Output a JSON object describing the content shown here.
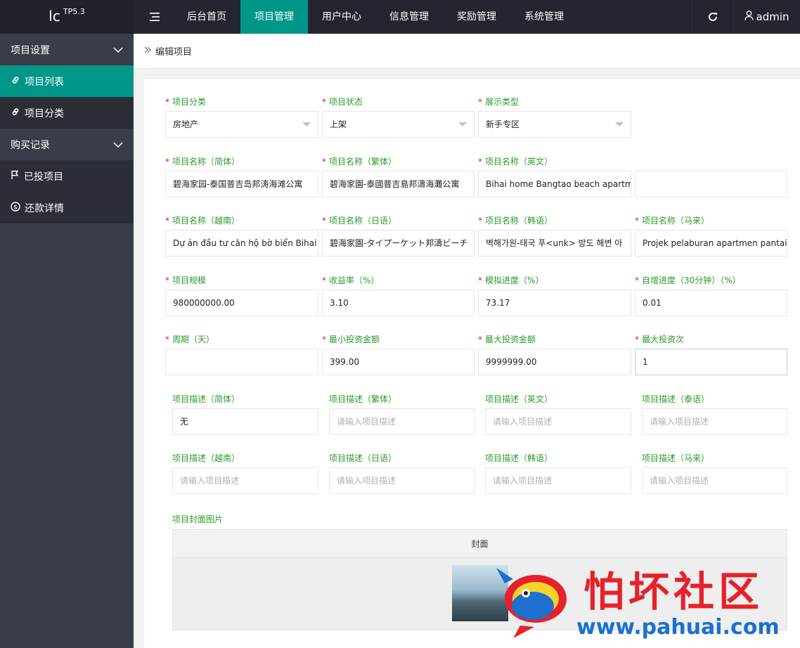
{
  "logo": {
    "text": "lc",
    "version": "TP5.3"
  },
  "nav": [
    "后台首页",
    "项目管理",
    "用户中心",
    "信息管理",
    "奖励管理",
    "系统管理"
  ],
  "user": {
    "name": "admin"
  },
  "sidebar": {
    "group1": "项目设置",
    "item_list": "项目列表",
    "item_category": "项目分类",
    "group2": "购买记录",
    "item_invested": "已投项目",
    "item_repay": "还款详情"
  },
  "breadcrumb": "编辑项目",
  "form": {
    "category": {
      "label": "项目分类",
      "value": "房地产"
    },
    "status": {
      "label": "项目状态",
      "value": "上架"
    },
    "display_type": {
      "label": "展示类型",
      "value": "新手专区"
    },
    "name_cn": {
      "label": "项目名称（简体）",
      "value": "碧海家园-泰国普吉岛邦涛海滩公寓"
    },
    "name_tw": {
      "label": "项目名称（繁体）",
      "value": "碧海家園-泰國普吉島邦濤海灘公寓"
    },
    "name_en": {
      "label": "项目名称（英文）",
      "value": "Bihai home Bangtao beach apartment"
    },
    "name_th": {
      "label": "",
      "value": ""
    },
    "name_vi": {
      "label": "项目名称（越南）",
      "value": "Dự án đầu tư căn hộ bờ biển Bihai ở"
    },
    "name_ja": {
      "label": "项目名称（日语）",
      "value": "碧海家園-タイプーケット邦濤ビーチ"
    },
    "name_ko": {
      "label": "项目名称（韩语）",
      "value": "벽해가원-태국 푸<unk> 방도 해변 아"
    },
    "name_ms": {
      "label": "项目名称（马来）",
      "value": "Projek pelaburan apartmen pantai"
    },
    "scale": {
      "label": "项目规模",
      "value": "980000000.00"
    },
    "yield": {
      "label": "收益率（%）",
      "value": "3.10"
    },
    "sim_progress": {
      "label": "模拟进度（%）",
      "value": "73.17"
    },
    "auto_progress": {
      "label": "自增进度（30分钟）（%）",
      "value": "0.01"
    },
    "period": {
      "label": "周期（天）",
      "value": ""
    },
    "min_invest": {
      "label": "最小投资金额",
      "value": "399.00"
    },
    "max_invest": {
      "label": "最大投资金额",
      "value": "9999999.00"
    },
    "max_count": {
      "label": "最大投资次",
      "value": "1"
    },
    "desc_cn": {
      "label": "项目描述（简体）",
      "value": "无"
    },
    "desc_tw": {
      "label": "项目描述（繁体）",
      "placeholder": "请输入项目描述"
    },
    "desc_en": {
      "label": "项目描述（英文）",
      "placeholder": "请输入项目描述"
    },
    "desc_th": {
      "label": "项目描述（泰语）",
      "placeholder": "请输入项目描述"
    },
    "desc_vi": {
      "label": "项目描述（越南）",
      "placeholder": "请输入项目描述"
    },
    "desc_ja": {
      "label": "项目描述（日语）",
      "placeholder": "请输入项目描述"
    },
    "desc_ko": {
      "label": "项目描述（韩语）",
      "placeholder": "请输入项目描述"
    },
    "desc_ms": {
      "label": "项目描述（马来）",
      "placeholder": "请输入项目描述"
    },
    "cover": {
      "label": "项目封面图片",
      "header": "封面"
    }
  },
  "watermark": {
    "title": "怕坏社区",
    "url": "www.pahuai.com"
  },
  "colors": {
    "accent": "#009688",
    "topbar": "#23262e",
    "sidebar": "#393d49",
    "label": "#2c9a2c",
    "required": "#e02020"
  }
}
